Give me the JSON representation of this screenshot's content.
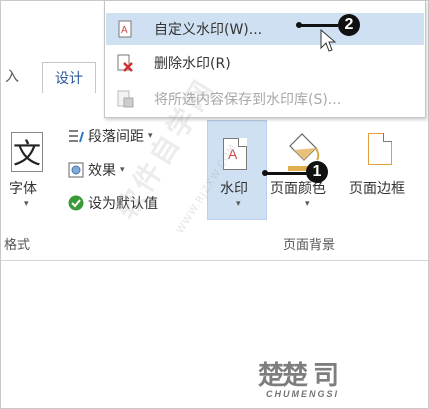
{
  "ribbon": {
    "tabs": [
      {
        "label": "入",
        "active": false
      },
      {
        "label": "设计",
        "active": true
      }
    ],
    "font_group": {
      "big_label_glyph": "文",
      "big_label": "字体",
      "paragraph_spacing": "段落间距",
      "effects": "效果",
      "set_default": "设为默认值",
      "group_label": "格式"
    },
    "background_group": {
      "watermark": "水印",
      "page_color": "页面颜色",
      "page_borders": "页面边框",
      "group_label": "页面背景"
    }
  },
  "menu": {
    "items": [
      {
        "label": "自定义水印(W)...",
        "enabled": true,
        "highlighted": true,
        "icon": "custom-watermark-icon"
      },
      {
        "label": "删除水印(R)",
        "enabled": true,
        "highlighted": false,
        "icon": "remove-watermark-icon"
      },
      {
        "label": "将所选内容保存到水印库(S)...",
        "enabled": false,
        "highlighted": false,
        "icon": "save-to-gallery-icon"
      }
    ]
  },
  "callouts": [
    {
      "number": "1"
    },
    {
      "number": "2"
    }
  ],
  "watermark_overlay": {
    "text": "软件自学网",
    "url": "WWW.RJZXW.COM"
  },
  "brand": {
    "mark": "楚楚 司",
    "text": "CHUMENGSI"
  },
  "colors": {
    "highlight": "#cfe0f3",
    "tab_active": "#2b579a",
    "disabled": "#a8a8a8"
  }
}
